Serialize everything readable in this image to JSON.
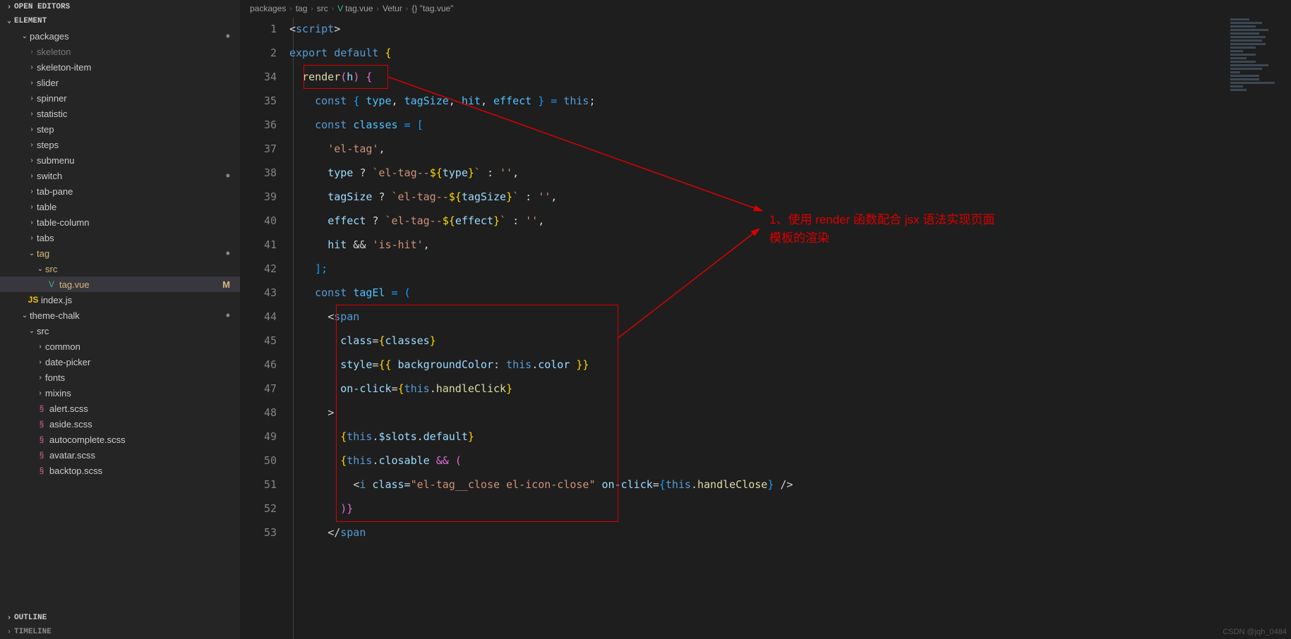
{
  "panels": {
    "open_editors": "OPEN EDITORS",
    "element": "ELEMENT",
    "outline": "OUTLINE",
    "timeline": "TIMELINE"
  },
  "tree": {
    "packages": "packages",
    "skeleton": "skeleton",
    "skeleton_item": "skeleton-item",
    "slider": "slider",
    "spinner": "spinner",
    "statistic": "statistic",
    "step": "step",
    "steps": "steps",
    "submenu": "submenu",
    "switch": "switch",
    "tab_pane": "tab-pane",
    "table": "table",
    "table_column": "table-column",
    "tabs": "tabs",
    "tag": "tag",
    "src": "src",
    "tag_vue": "tag.vue",
    "mod_badge": "M",
    "index_js": "index.js",
    "theme_chalk": "theme-chalk",
    "src2": "src",
    "common": "common",
    "date_picker": "date-picker",
    "fonts": "fonts",
    "mixins": "mixins",
    "alert_scss": "alert.scss",
    "aside_scss": "aside.scss",
    "autocomplete_scss": "autocomplete.scss",
    "avatar_scss": "avatar.scss",
    "backtop_scss": "backtop.scss"
  },
  "breadcrumb": {
    "c1": "packages",
    "c2": "tag",
    "c3": "src",
    "c4": "tag.vue",
    "c5": "Vetur",
    "c6": "{} \"tag.vue\""
  },
  "lines": [
    "1",
    "2",
    "34",
    "35",
    "36",
    "37",
    "38",
    "39",
    "40",
    "41",
    "42",
    "43",
    "44",
    "45",
    "46",
    "47",
    "48",
    "49",
    "50",
    "51",
    "52",
    "53"
  ],
  "code": {
    "l1a": "<",
    "l1b": "script",
    "l1c": ">",
    "l2a": "export",
    "l2b": " default ",
    "l2c": "{",
    "l34a": "render",
    "l34b": "(",
    "l34c": "h",
    "l34d": ") ",
    "l34e": "{",
    "l35a": "const ",
    "l35b": "{ ",
    "l35c": "type",
    "l35d": ", ",
    "l35e": "tagSize",
    "l35f": ", ",
    "l35g": "hit",
    "l35h": ", ",
    "l35i": "effect",
    "l35j": " } = ",
    "l35k": "this",
    "l35l": ";",
    "l36a": "const ",
    "l36b": "classes",
    "l36c": " = [",
    "l37": "'el-tag'",
    "l37b": ",",
    "l38a": "type",
    "l38b": " ? ",
    "l38c": "`el-tag--",
    "l38d": "${",
    "l38e": "type",
    "l38f": "}",
    "l38g": "`",
    "l38h": " : ",
    "l38i": "''",
    "l38j": ",",
    "l39a": "tagSize",
    "l39b": " ? ",
    "l39c": "`el-tag--",
    "l39d": "${",
    "l39e": "tagSize",
    "l39f": "}",
    "l39g": "`",
    "l39h": " : ",
    "l39i": "''",
    "l39j": ",",
    "l40a": "effect",
    "l40b": " ? ",
    "l40c": "`el-tag--",
    "l40d": "${",
    "l40e": "effect",
    "l40f": "}",
    "l40g": "`",
    "l40h": " : ",
    "l40i": "''",
    "l40j": ",",
    "l41a": "hit",
    "l41b": " && ",
    "l41c": "'is-hit'",
    "l41d": ",",
    "l42": "];",
    "l43a": "const ",
    "l43b": "tagEl",
    "l43c": " = (",
    "l44a": "<",
    "l44b": "span",
    "l45a": "class",
    "l45b": "=",
    "l45c": "{",
    "l45d": "classes",
    "l45e": "}",
    "l46a": "style",
    "l46b": "=",
    "l46c": "{{ ",
    "l46d": "backgroundColor",
    "l46e": ": ",
    "l46f": "this",
    "l46g": ".",
    "l46h": "color",
    "l46i": " }}",
    "l47a": "on-click",
    "l47b": "=",
    "l47c": "{",
    "l47d": "this",
    "l47e": ".",
    "l47f": "handleClick",
    "l47g": "}",
    "l48": ">",
    "l49a": "{",
    "l49b": "this",
    "l49c": ".",
    "l49d": "$slots",
    "l49e": ".",
    "l49f": "default",
    "l49g": "}",
    "l50a": "{",
    "l50b": "this",
    "l50c": ".",
    "l50d": "closable",
    "l50e": " && (",
    "l51a": "<",
    "l51b": "i",
    "l51c": " ",
    "l51d": "class",
    "l51e": "=",
    "l51f": "\"el-tag__close el-icon-close\"",
    "l51g": " ",
    "l51h": "on-click",
    "l51i": "=",
    "l51j": "{",
    "l51k": "this",
    "l51l": ".",
    "l51m": "handleClose",
    "l51n": "}",
    "l51o": " />",
    "l52": ")}",
    "l53a": "</",
    "l53b": "span"
  },
  "annotation": {
    "line1": "1、使用 render 函数配合 jsx 语法实现页面",
    "line2": "模板的渲染"
  },
  "watermark": "CSDN @jqh_0484"
}
